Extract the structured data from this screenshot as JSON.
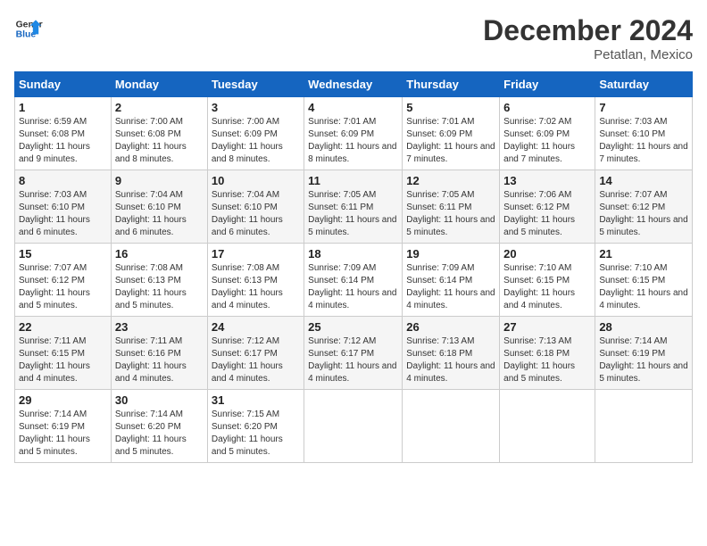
{
  "header": {
    "logo_line1": "General",
    "logo_line2": "Blue",
    "title": "December 2024",
    "subtitle": "Petatlan, Mexico"
  },
  "columns": [
    "Sunday",
    "Monday",
    "Tuesday",
    "Wednesday",
    "Thursday",
    "Friday",
    "Saturday"
  ],
  "weeks": [
    [
      {
        "day": "1",
        "rise": "6:59 AM",
        "set": "6:08 PM",
        "daylight": "11 hours and 9 minutes."
      },
      {
        "day": "2",
        "rise": "7:00 AM",
        "set": "6:08 PM",
        "daylight": "11 hours and 8 minutes."
      },
      {
        "day": "3",
        "rise": "7:00 AM",
        "set": "6:09 PM",
        "daylight": "11 hours and 8 minutes."
      },
      {
        "day": "4",
        "rise": "7:01 AM",
        "set": "6:09 PM",
        "daylight": "11 hours and 8 minutes."
      },
      {
        "day": "5",
        "rise": "7:01 AM",
        "set": "6:09 PM",
        "daylight": "11 hours and 7 minutes."
      },
      {
        "day": "6",
        "rise": "7:02 AM",
        "set": "6:09 PM",
        "daylight": "11 hours and 7 minutes."
      },
      {
        "day": "7",
        "rise": "7:03 AM",
        "set": "6:10 PM",
        "daylight": "11 hours and 7 minutes."
      }
    ],
    [
      {
        "day": "8",
        "rise": "7:03 AM",
        "set": "6:10 PM",
        "daylight": "11 hours and 6 minutes."
      },
      {
        "day": "9",
        "rise": "7:04 AM",
        "set": "6:10 PM",
        "daylight": "11 hours and 6 minutes."
      },
      {
        "day": "10",
        "rise": "7:04 AM",
        "set": "6:10 PM",
        "daylight": "11 hours and 6 minutes."
      },
      {
        "day": "11",
        "rise": "7:05 AM",
        "set": "6:11 PM",
        "daylight": "11 hours and 5 minutes."
      },
      {
        "day": "12",
        "rise": "7:05 AM",
        "set": "6:11 PM",
        "daylight": "11 hours and 5 minutes."
      },
      {
        "day": "13",
        "rise": "7:06 AM",
        "set": "6:12 PM",
        "daylight": "11 hours and 5 minutes."
      },
      {
        "day": "14",
        "rise": "7:07 AM",
        "set": "6:12 PM",
        "daylight": "11 hours and 5 minutes."
      }
    ],
    [
      {
        "day": "15",
        "rise": "7:07 AM",
        "set": "6:12 PM",
        "daylight": "11 hours and 5 minutes."
      },
      {
        "day": "16",
        "rise": "7:08 AM",
        "set": "6:13 PM",
        "daylight": "11 hours and 5 minutes."
      },
      {
        "day": "17",
        "rise": "7:08 AM",
        "set": "6:13 PM",
        "daylight": "11 hours and 4 minutes."
      },
      {
        "day": "18",
        "rise": "7:09 AM",
        "set": "6:14 PM",
        "daylight": "11 hours and 4 minutes."
      },
      {
        "day": "19",
        "rise": "7:09 AM",
        "set": "6:14 PM",
        "daylight": "11 hours and 4 minutes."
      },
      {
        "day": "20",
        "rise": "7:10 AM",
        "set": "6:15 PM",
        "daylight": "11 hours and 4 minutes."
      },
      {
        "day": "21",
        "rise": "7:10 AM",
        "set": "6:15 PM",
        "daylight": "11 hours and 4 minutes."
      }
    ],
    [
      {
        "day": "22",
        "rise": "7:11 AM",
        "set": "6:15 PM",
        "daylight": "11 hours and 4 minutes."
      },
      {
        "day": "23",
        "rise": "7:11 AM",
        "set": "6:16 PM",
        "daylight": "11 hours and 4 minutes."
      },
      {
        "day": "24",
        "rise": "7:12 AM",
        "set": "6:17 PM",
        "daylight": "11 hours and 4 minutes."
      },
      {
        "day": "25",
        "rise": "7:12 AM",
        "set": "6:17 PM",
        "daylight": "11 hours and 4 minutes."
      },
      {
        "day": "26",
        "rise": "7:13 AM",
        "set": "6:18 PM",
        "daylight": "11 hours and 4 minutes."
      },
      {
        "day": "27",
        "rise": "7:13 AM",
        "set": "6:18 PM",
        "daylight": "11 hours and 5 minutes."
      },
      {
        "day": "28",
        "rise": "7:14 AM",
        "set": "6:19 PM",
        "daylight": "11 hours and 5 minutes."
      }
    ],
    [
      {
        "day": "29",
        "rise": "7:14 AM",
        "set": "6:19 PM",
        "daylight": "11 hours and 5 minutes."
      },
      {
        "day": "30",
        "rise": "7:14 AM",
        "set": "6:20 PM",
        "daylight": "11 hours and 5 minutes."
      },
      {
        "day": "31",
        "rise": "7:15 AM",
        "set": "6:20 PM",
        "daylight": "11 hours and 5 minutes."
      },
      null,
      null,
      null,
      null
    ]
  ]
}
